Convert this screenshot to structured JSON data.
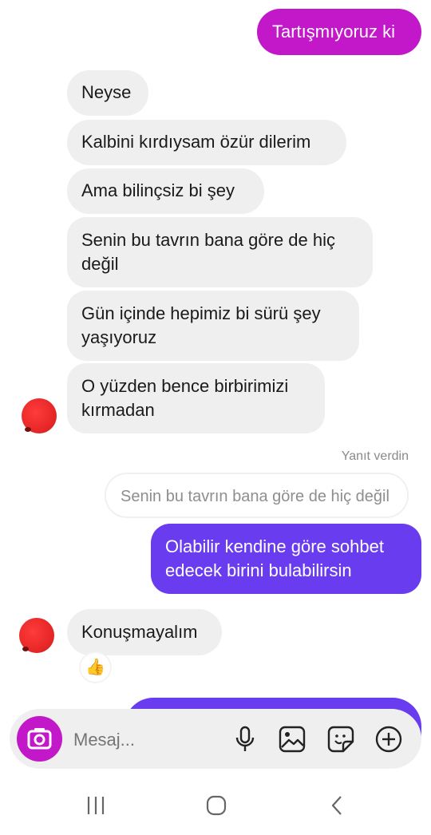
{
  "messages": {
    "m1": "Tartışmıyoruz ki",
    "m2": "Neyse",
    "m3": "Kalbini kırdıysam özür dilerim",
    "m4": "Ama bilinçsiz bi şey",
    "m5": "Senin bu tavrın bana göre de hiç değil",
    "m6": "Gün içinde hepimiz bi sürü şey yaşıyoruz",
    "m7": "O yüzden bence birbirimizi kırmadan",
    "reply_label": "Yanıt verdin",
    "quoted": "Senin bu tavrın bana göre de hiç değil",
    "m8": "Olabilir kendine göre sohbet edecek birini bulabilirsin",
    "m9": "Konuşmayalım",
    "reaction": "👍"
  },
  "composer": {
    "placeholder": "Mesaj..."
  },
  "colors": {
    "outgoing_magenta": "#c218c9",
    "outgoing_purple": "#6a3cf0",
    "camera": "#c218c9",
    "incoming": "#efefef"
  },
  "icons": [
    "camera-icon",
    "microphone-icon",
    "gallery-icon",
    "sticker-icon",
    "plus-icon",
    "recents-icon",
    "home-icon",
    "back-icon"
  ]
}
